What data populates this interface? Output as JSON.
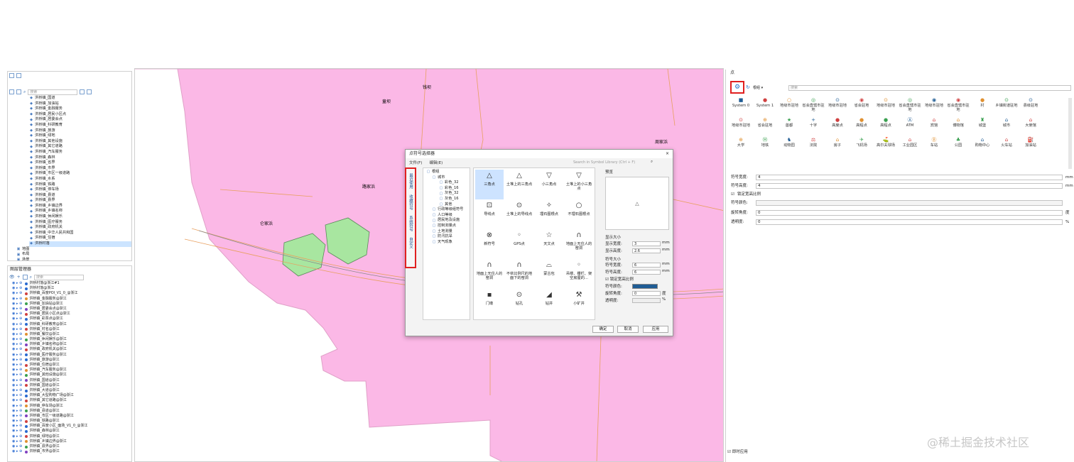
{
  "left_tree": {
    "items": [
      "洪桥镇_国道",
      "洪桥镇_加油站",
      "洪桥镇_金融服务",
      "洪桥镇_居民小区点",
      "洪桥镇_居委会点",
      "洪桥镇_科研教育",
      "洪桥镇_旅游",
      "洪桥镇_绿地",
      "洪桥镇_其他设施",
      "洪桥镇_其它道路",
      "洪桥镇_汽车服务",
      "洪桥镇_森林",
      "洪桥镇_省界",
      "洪桥镇_市界",
      "洪桥镇_市区一级道路",
      "洪桥镇_水系",
      "洪桥镇_铁路",
      "洪桥镇_停车场",
      "洪桥镇_县道",
      "洪桥镇_县界",
      "洪桥镇_乡镇边界",
      "洪桥镇_乡镇名称",
      "洪桥镇_休闲娱乐",
      "洪桥镇_医疗服务",
      "洪桥镇_政府机关",
      "洪桥镇_中华人民共和国",
      "洪桥镇_住宿",
      "洪桥村落"
    ],
    "extra": [
      "地图",
      "布局",
      "场景",
      "资源"
    ],
    "search_placeholder": "搜索"
  },
  "layer_manager": {
    "title": "图层管理器",
    "search_placeholder": "搜索",
    "items": [
      "洪桥村落@浙江#1",
      "洪桥村落@浙江",
      "洪桥镇_百度POI_V1_0_@浙江",
      "洪桥镇_金融服务@浙江",
      "洪桥镇_加油站@浙江",
      "洪桥镇_居委会点@浙江",
      "洪桥镇_居民小区点@浙江",
      "洪桥镇_彩票点@浙江",
      "洪桥镇_科研教育@浙江",
      "洪桥镇_村名@浙江",
      "洪桥镇_餐饮@浙江",
      "洪桥镇_休闲娱乐@浙江",
      "洪桥镇_乡镇名称@浙江",
      "洪桥镇_政府机关@浙江",
      "洪桥镇_医疗服务@浙江",
      "洪桥镇_旅游@浙江",
      "洪桥镇_住宿@浙江",
      "洪桥镇_汽车服务@浙江",
      "洪桥镇_其他设施@浙江",
      "洪桥镇_国道@浙江",
      "洪桥镇_国道@浙江",
      "洪桥镇_大道@浙江",
      "洪桥镇_大型购物广场@浙江",
      "洪桥镇_其它道路@浙江",
      "洪桥镇_停车场@浙江",
      "洪桥镇_县道@浙江",
      "洪桥镇_市区一级道路@浙江",
      "洪桥镇_铁路@浙江",
      "洪桥镇_百度小区_面场_V1_0_@浙江",
      "洪桥镇_森林@浙江",
      "洪桥镇_绿地@浙江",
      "洪桥镇_乡镇边界@浙江",
      "洪桥镇_县界@浙江",
      "洪桥镇_市界@浙江"
    ]
  },
  "map": {
    "labels": [
      "钱坝",
      "童坝",
      "路家浜",
      "周家浜",
      "仑家浜",
      "邱家浜"
    ]
  },
  "dialog": {
    "title": "点符号选择器",
    "menu": [
      "文件(F)",
      "编辑(E)"
    ],
    "search_placeholder": "Search in Symbol Library (Ctrl + F)",
    "side_tabs": [
      "最近使用",
      "收藏符号",
      "系统符号",
      "自定义"
    ],
    "tree": [
      "根组",
      "城市",
      "彩色_32",
      "彩色_16",
      "灰色_32",
      "灰色_16",
      "其他",
      "行政等级组符号",
      "人口等级",
      "居民地及设施",
      "控制测量点",
      "土地测量",
      "防汛抗旱",
      "天气现象"
    ],
    "symbols": [
      "三角点",
      "土堆上的三角点",
      "小三角点",
      "土堆上的小三角点",
      "导线点",
      "土堆上的导线点",
      "埋石图根点",
      "不埋石图根点",
      "新符号",
      "GPS点",
      "天文点",
      "地面上无住人的窑洞",
      "地面上无住人的窑洞",
      "不依比例尺的地面下的窑洞",
      "蒙古包",
      "吊楼、栅栏、架空房屋的...",
      "门墩",
      "钻孔",
      "钻井",
      "小矿井"
    ],
    "preview_label": "预览",
    "display_size": "显示大小",
    "display_width_label": "显示宽度:",
    "display_width": "3",
    "display_height_label": "显示高度:",
    "display_height": "2.6",
    "symbol_size": "符号大小",
    "symbol_width_label": "符号宽度:",
    "symbol_width": "6",
    "symbol_height_label": "符号高度:",
    "symbol_height": "6",
    "lock_ratio": "锁定宽高比例",
    "color_label": "符号颜色:",
    "rotation_label": "旋转角度:",
    "rotation": "0",
    "opacity_label": "透明度:",
    "unit_mm": "mm",
    "unit_deg": "度",
    "unit_pct": "%",
    "ok": "确定",
    "cancel": "取消",
    "apply": "应用"
  },
  "right_panel": {
    "title": "点",
    "root": "根组",
    "search_placeholder": "搜索",
    "symbols_row1": [
      "System 0",
      "System 1",
      "地级市驻地",
      "省会直辖市驻地",
      "地级市驻地",
      "省会驻地",
      "地级市驻地",
      "省会直辖市驻地",
      "地级市驻地",
      "省会直辖市驻地",
      "村",
      "乡镇街道驻地",
      "县级驻地"
    ],
    "symbols_row2": [
      "地级市驻地",
      "省会驻地",
      "首都",
      "十字",
      "高度点",
      "高程点",
      "高程点",
      "ATM",
      "宾馆",
      "博物馆",
      "城堡",
      "城市",
      "大使馆"
    ],
    "symbols_row3": [
      "大学",
      "地铁",
      "动物园",
      "法院",
      "房子",
      "飞机场",
      "高尔夫球场",
      "工业园区",
      "车站",
      "公园",
      "购物中心",
      "火车站",
      "加油站"
    ],
    "symbol_width_label": "符号宽度:",
    "symbol_width": "4",
    "symbol_height_label": "符号高度:",
    "symbol_height": "4",
    "lock_ratio": "锁定宽高比例",
    "color_label": "符号颜色:",
    "rotation_label": "旋转角度:",
    "rotation": "0",
    "opacity_label": "透明度:",
    "opacity": "0",
    "unit_mm": "mm",
    "unit_deg": "度",
    "unit_pct": "%",
    "instant_apply": "即时应用"
  },
  "watermark": "@稀土掘金技术社区",
  "colors": {
    "land": "#fbb8e6",
    "green": "#a8e6a0",
    "road": "#e8a060",
    "highlight": "#e02020",
    "accent": "#1f6fc8"
  }
}
